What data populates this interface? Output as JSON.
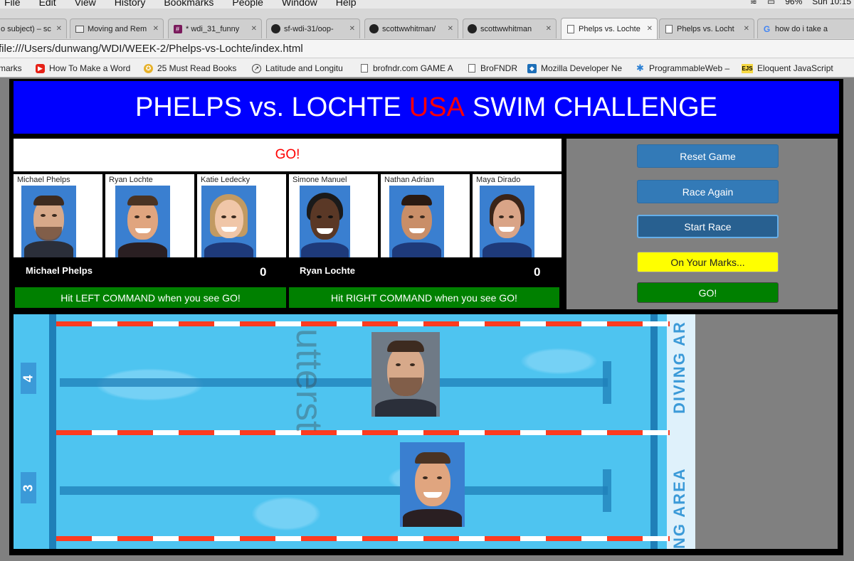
{
  "menubar": {
    "items": [
      "File",
      "Edit",
      "View",
      "History",
      "Bookmarks",
      "People",
      "Window",
      "Help"
    ],
    "battery": "96%",
    "clock": "Sun 10:15"
  },
  "tabs": [
    {
      "label": "o subject) – sc",
      "icon": "mail-icon",
      "active": false
    },
    {
      "label": "Moving and Rem",
      "icon": "book-icon",
      "active": false
    },
    {
      "label": "* wdi_31_funny",
      "icon": "slack-icon",
      "active": false
    },
    {
      "label": "sf-wdi-31/oop-",
      "icon": "github-icon",
      "active": false
    },
    {
      "label": "scottwwhitman/",
      "icon": "github-icon",
      "active": false
    },
    {
      "label": "scottwwhitman",
      "icon": "github-icon",
      "active": false
    },
    {
      "label": "Phelps vs. Lochte",
      "icon": "document-icon",
      "active": true
    },
    {
      "label": "Phelps vs. Locht",
      "icon": "document-icon",
      "active": false
    },
    {
      "label": "how do i take a",
      "icon": "google-icon",
      "active": false
    }
  ],
  "address": {
    "url": "file:///Users/dunwang/WDI/WEEK-2/Phelps-vs-Lochte/index.html"
  },
  "bookmarks": [
    {
      "label": "marks",
      "icon": ""
    },
    {
      "label": "How To Make a Word",
      "icon": "youtube-icon"
    },
    {
      "label": "25 Must Read Books",
      "icon": "star-icon"
    },
    {
      "label": "Latitude and Longitu",
      "icon": "compass-icon"
    },
    {
      "label": "brofndr.com GAME A",
      "icon": "document-icon"
    },
    {
      "label": "BroFNDR",
      "icon": "document-icon"
    },
    {
      "label": "Mozilla Developer Ne",
      "icon": "mdn-icon"
    },
    {
      "label": "ProgrammableWeb –",
      "icon": "gear-icon"
    },
    {
      "label": "Eloquent JavaScript",
      "icon": "ejs-icon"
    }
  ],
  "game": {
    "title_part1": "PHELPS vs. LOCHTE",
    "title_usa": "USA",
    "title_part2": "SWIM CHALLENGE",
    "status": "GO!",
    "swimmers": [
      {
        "name": "Michael Phelps"
      },
      {
        "name": "Ryan Lochte"
      },
      {
        "name": "Katie Ledecky"
      },
      {
        "name": "Simone Manuel"
      },
      {
        "name": "Nathan Adrian"
      },
      {
        "name": "Maya Dirado"
      }
    ],
    "player1": {
      "name": "Michael Phelps",
      "score": "0",
      "hint": "Hit LEFT COMMAND when you see GO!"
    },
    "player2": {
      "name": "Ryan Lochte",
      "score": "0",
      "hint": "Hit RIGHT COMMAND when you see GO!"
    },
    "buttons": {
      "reset": "Reset Game",
      "again": "Race Again",
      "start": "Start Race",
      "marks": "On Your Marks...",
      "go": "GO!"
    }
  },
  "pool": {
    "lane_top": "4",
    "lane_bottom": "3",
    "side_text_1": "DIVING AR",
    "side_text_2": "NG AREA",
    "watermark": "utterst",
    "racers": [
      "Michael Phelps",
      "Ryan Lochte"
    ]
  }
}
